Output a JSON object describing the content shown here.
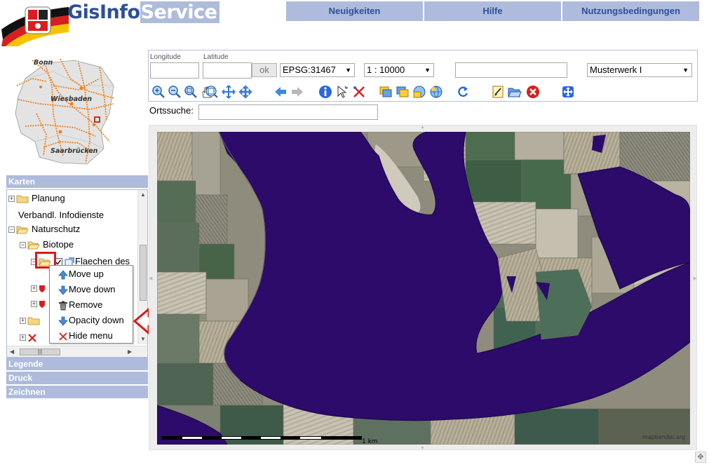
{
  "header": {
    "brand_part1": "GisInfo",
    "brand_part2": "Service",
    "nav": [
      "Neuigkeiten",
      "Hilfe",
      "Nutzungsbedingungen"
    ]
  },
  "overview_map": {
    "labels": [
      "Bonn",
      "Wiesbaden",
      "Saarbrücken"
    ]
  },
  "accordion": {
    "karten": "Karten",
    "legende": "Legende",
    "druck": "Druck",
    "zeichnen": "Zeichnen"
  },
  "tree": {
    "planung": "Planung",
    "verbandl": "Verbandl. Infodienste",
    "naturschutz": "Naturschutz",
    "biotope": "Biotope",
    "flaechen": "Flaechen des"
  },
  "context_menu": {
    "items": [
      "Move up",
      "Move down",
      "Remove",
      "Opacity down",
      "Hide menu"
    ]
  },
  "toolbar": {
    "longitude_label": "Longitude",
    "latitude_label": "Latitude",
    "ok_label": "ok",
    "epsg": "EPSG:31467",
    "scale": "1 : 10000",
    "project": "Musterwerk I",
    "ortssuche_label": "Ortssuche:"
  },
  "map": {
    "scale_label": "1 km",
    "watermark": "mapbender.org"
  },
  "colors": {
    "accent": "#aebbdc",
    "brand_blue": "#2e4f98",
    "water_overlay": "#2c0b6b",
    "annotation_red": "#e01818"
  }
}
